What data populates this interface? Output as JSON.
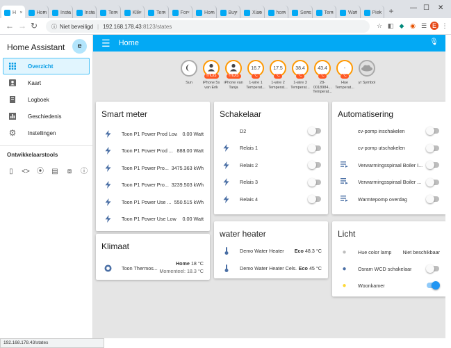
{
  "browser": {
    "tabs": [
      {
        "label": "H"
      },
      {
        "label": "Hom"
      },
      {
        "label": "Insta"
      },
      {
        "label": "Insta"
      },
      {
        "label": "Tem"
      },
      {
        "label": "Klik"
      },
      {
        "label": "Tem"
      },
      {
        "label": "For"
      },
      {
        "label": "Hom"
      },
      {
        "label": "Buy"
      },
      {
        "label": "Xiao"
      },
      {
        "label": "hom"
      },
      {
        "label": "Sens"
      },
      {
        "label": "Tem"
      },
      {
        "label": "Wat"
      },
      {
        "label": "Piek"
      }
    ],
    "security": "Niet beveiligd",
    "url_host": "192.168.178.43",
    "url_path": ":8123/states",
    "status_url": "192.168.178.43/states"
  },
  "sidebar": {
    "title": "Home Assistant",
    "avatar": "e",
    "items": [
      {
        "label": "Overzicht",
        "icon": "apps-icon"
      },
      {
        "label": "Kaart",
        "icon": "account-box-icon"
      },
      {
        "label": "Logboek",
        "icon": "book-icon"
      },
      {
        "label": "Geschiedenis",
        "icon": "chart-icon"
      },
      {
        "label": "Instellingen",
        "icon": "gear-icon"
      }
    ],
    "dev_title": "Ontwikkelaarstools"
  },
  "header": {
    "title": "Home"
  },
  "badges": [
    {
      "value": "",
      "unit": "",
      "label": "Sun",
      "icon": "moon-icon"
    },
    {
      "value": "",
      "unit": "THUIS",
      "label": "iPhone 5s van Erik",
      "icon": "person-icon"
    },
    {
      "value": "",
      "unit": "THUIS",
      "label": "iPhone van Tanja",
      "icon": "person-icon"
    },
    {
      "value": "16.7",
      "unit": "°C",
      "label": "1-wire 1 Temperat...",
      "icon": ""
    },
    {
      "value": "17.5",
      "unit": "°C",
      "label": "1-wire 2 Temperat...",
      "icon": ""
    },
    {
      "value": "38.4",
      "unit": "°C",
      "label": "1-wire 3 Temperat...",
      "icon": ""
    },
    {
      "value": "43.4",
      "unit": "°C",
      "label": "28-0018984... Temperat...",
      "icon": ""
    },
    {
      "value": "-",
      "unit": "°C",
      "label": "Hue Temperat...",
      "icon": ""
    },
    {
      "value": "",
      "unit": "",
      "label": "yr Symbol",
      "icon": "cloud-icon"
    }
  ],
  "cards": {
    "smart_meter": {
      "title": "Smart meter",
      "rows": [
        {
          "name": "Toon P1 Power Prod Low",
          "value": "0.00 Watt"
        },
        {
          "name": "Toon P1 Power Prod ...",
          "value": "888.00 Watt"
        },
        {
          "name": "Toon P1 Power Pro...",
          "value": "3475.363 kWh"
        },
        {
          "name": "Toon P1 Power Pro...",
          "value": "3239.503 kWh"
        },
        {
          "name": "Toon P1 Power Use ...",
          "value": "550.515 kWh"
        },
        {
          "name": "Toon P1 Power Use Low",
          "value": "0.00 Watt"
        }
      ]
    },
    "klimaat": {
      "title": "Klimaat",
      "name": "Toon Thermos...",
      "mode": "Home",
      "setpoint": "18 °C",
      "current": "Momenteel: 18.3 °C"
    },
    "schakelaar": {
      "title": "Schakelaar",
      "rows": [
        {
          "name": "D2",
          "on": false
        },
        {
          "name": "Relais 1",
          "on": false
        },
        {
          "name": "Relais 2",
          "on": false
        },
        {
          "name": "Relais 3",
          "on": false
        },
        {
          "name": "Relais 4",
          "on": false
        }
      ]
    },
    "water_heater": {
      "title": "water heater",
      "rows": [
        {
          "name": "Demo Water Heater",
          "mode": "Eco",
          "temp": "48.3 °C"
        },
        {
          "name": "Demo Water Heater Cels...",
          "mode": "Eco",
          "temp": "45 °C"
        }
      ]
    },
    "automatisering": {
      "title": "Automatisering",
      "rows": [
        {
          "name": "cv-pomp inschakelen",
          "on": false
        },
        {
          "name": "cv-pomp utschakelen",
          "on": false
        },
        {
          "name": "Verwarmingsspiraal Boiler I...",
          "on": false
        },
        {
          "name": "Verwarmingsspiraal Boiler ...",
          "on": false
        },
        {
          "name": "Warmtepomp overdag",
          "on": false
        }
      ]
    },
    "licht": {
      "title": "Licht",
      "rows": [
        {
          "name": "Hue color lamp",
          "value": "Niet beschikbaar"
        },
        {
          "name": "Osram WCD schakelaar",
          "on": false
        },
        {
          "name": "Woonkamer",
          "on": true
        }
      ]
    }
  },
  "colors": {
    "accent": "#03a9f4",
    "badge_border": "#ff9800",
    "badge_unit": "#ff5722",
    "toggle_on": "#2196f3"
  }
}
